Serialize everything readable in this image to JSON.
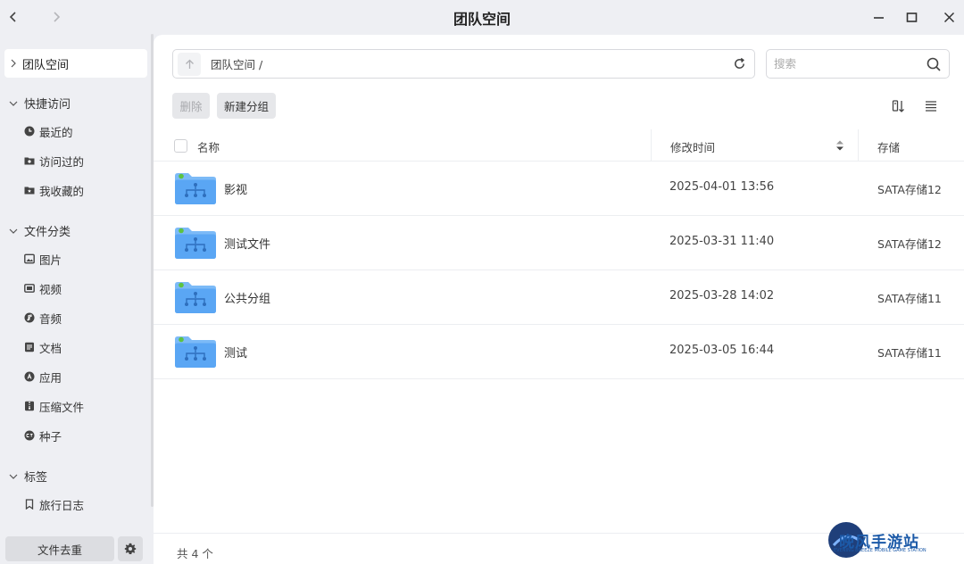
{
  "window": {
    "title": "团队空间"
  },
  "sidebar": {
    "top_item": "团队空间",
    "groups": [
      {
        "label": "快捷访问",
        "items": [
          "最近的",
          "访问过的",
          "我收藏的"
        ]
      },
      {
        "label": "文件分类",
        "items": [
          "图片",
          "视频",
          "音频",
          "文档",
          "应用",
          "压缩文件",
          "种子"
        ]
      },
      {
        "label": "标签",
        "items": [
          "旅行日志"
        ]
      }
    ],
    "dedupe_label": "文件去重"
  },
  "toolbar": {
    "path": "团队空间 /",
    "search_placeholder": "搜索",
    "delete_label": "删除",
    "new_group_label": "新建分组"
  },
  "table": {
    "columns": {
      "name": "名称",
      "modified": "修改时间",
      "storage": "存储"
    },
    "rows": [
      {
        "name": "影视",
        "modified": "2025-04-01 13:56",
        "storage": "SATA存储12"
      },
      {
        "name": "测试文件",
        "modified": "2025-03-31 11:40",
        "storage": "SATA存储12"
      },
      {
        "name": "公共分组",
        "modified": "2025-03-28 14:02",
        "storage": "SATA存储11"
      },
      {
        "name": "测试",
        "modified": "2025-03-05 16:44",
        "storage": "SATA存储11"
      }
    ]
  },
  "footer": {
    "count": "共 4 个"
  },
  "watermark": {
    "title": "晚风手游站",
    "subtitle": "EVENING BREEZE MOBILE GAME STATION"
  },
  "colors": {
    "accent": "#4a9ff5",
    "folder_dot": "#5cc341",
    "page_bg": "#eeeff3"
  }
}
